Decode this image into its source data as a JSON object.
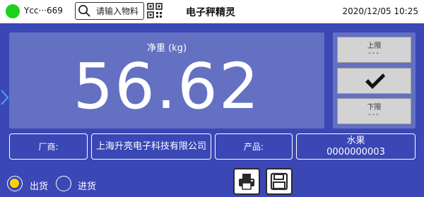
{
  "topbar": {
    "connection_label": "Ycc···669",
    "search_placeholder": "请输入物料",
    "title": "电子秤精灵",
    "datetime": "2020/12/05 10:25"
  },
  "weight": {
    "label": "净重 (kg)",
    "value": "56.62"
  },
  "limits": {
    "upper_label": "上限",
    "upper_value": "---",
    "lower_label": "下限",
    "lower_value": "---"
  },
  "info": {
    "vendor_label": "厂商:",
    "vendor_name": "上海升亮电子科技有限公司",
    "product_label": "产品:",
    "product_name": "水果",
    "product_code": "0000000003"
  },
  "mode": {
    "options": [
      {
        "label": "出货",
        "selected": true
      },
      {
        "label": "进货",
        "selected": false
      }
    ]
  },
  "colors": {
    "background": "#3a47b5",
    "panel": "#6470c2",
    "status_online": "#1bd11b",
    "radio_selected": "#f7d308"
  },
  "icons": {
    "search": "search-icon",
    "scan": "qr-code-icon",
    "check": "checkmark-icon",
    "print": "printer-icon",
    "save": "save-icon",
    "side": "chevron-right-icon"
  }
}
